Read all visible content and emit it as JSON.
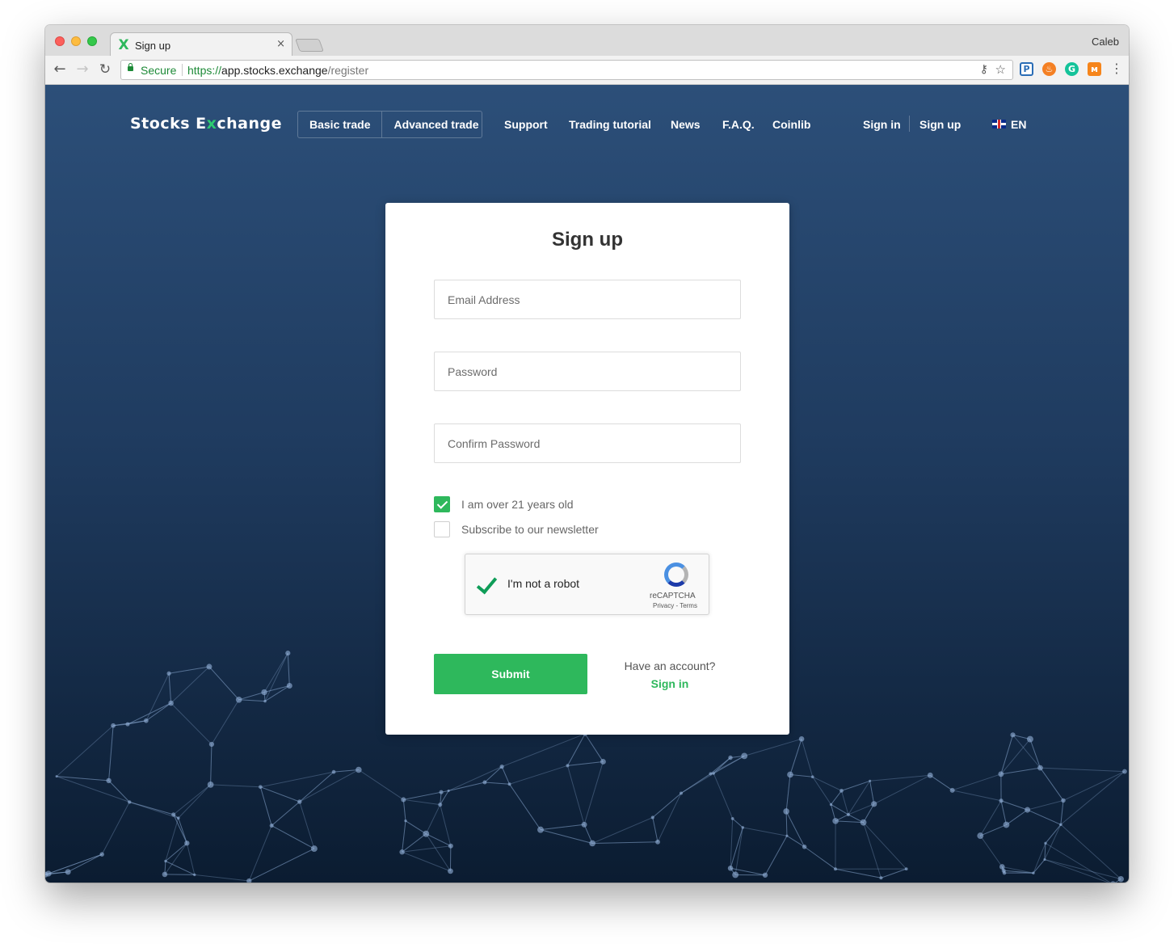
{
  "browser": {
    "tab_title": "Sign up",
    "tab_close": "×",
    "profile_name": "Caleb",
    "secure_label": "Secure",
    "url_scheme": "https://",
    "url_host": "app.stocks.exchange",
    "url_path": "/register",
    "favicon": "X",
    "extensions": [
      "P",
      "♨",
      "G",
      "ᴍ"
    ]
  },
  "nav": {
    "logo_pre": "Stocks E",
    "logo_x": "x",
    "logo_post": "change",
    "basic_trade": "Basic trade",
    "advanced_trade": "Advanced trade",
    "support": "Support",
    "trading_tutorial": "Trading tutorial",
    "news": "News",
    "faq": "F.A.Q.",
    "coinlib": "Coinlib",
    "sign_in": "Sign in",
    "sign_up": "Sign up",
    "language": "EN"
  },
  "form": {
    "title": "Sign up",
    "email_placeholder": "Email Address",
    "password_placeholder": "Password",
    "confirm_placeholder": "Confirm Password",
    "age_label": "I am over 21 years old",
    "age_checked": true,
    "newsletter_label": "Subscribe to our newsletter",
    "newsletter_checked": false,
    "recaptcha_label": "I'm not a robot",
    "recaptcha_brand": "reCAPTCHA",
    "recaptcha_links": "Privacy - Terms",
    "submit_label": "Submit",
    "have_account": "Have an account?",
    "sign_in": "Sign in"
  },
  "colors": {
    "accent": "#2eb85c",
    "bg_top": "#2c4f79",
    "bg_bottom": "#0b1c31"
  }
}
